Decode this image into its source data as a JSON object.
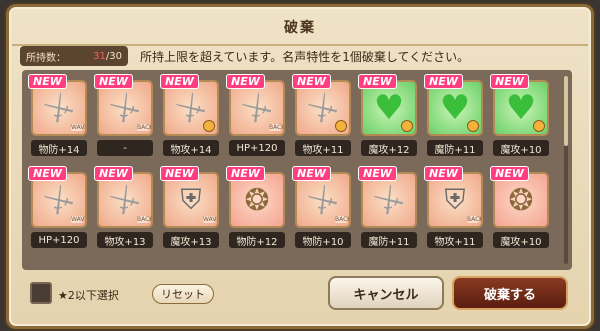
{
  "header": {
    "title": "破棄"
  },
  "inventory": {
    "label": "所持数：",
    "current": "31",
    "max": "/30"
  },
  "instruction": "所持上限を超えています。名声特性を1個破棄してください。",
  "items": [
    {
      "badge": "NEW",
      "icon": "sword-icon",
      "type": "sword",
      "bg": "peach",
      "tag": "WAVE",
      "stat": "物防+14"
    },
    {
      "badge": "NEW",
      "icon": "sword-icon",
      "type": "sword",
      "bg": "peach",
      "tag": "BACK",
      "stat": "-"
    },
    {
      "badge": "NEW",
      "icon": "sword-icon",
      "type": "sword",
      "bg": "peach",
      "tag": "orb",
      "stat": "物攻+14"
    },
    {
      "badge": "NEW",
      "icon": "sword-icon",
      "type": "sword",
      "bg": "peach",
      "tag": "BACK",
      "stat": "HP+120"
    },
    {
      "badge": "NEW",
      "icon": "sword-icon",
      "type": "sword",
      "bg": "peach",
      "tag": "orb",
      "stat": "物攻+11"
    },
    {
      "badge": "NEW",
      "icon": "heart-icon",
      "type": "heart",
      "bg": "green",
      "tag": "orb",
      "stat": "魔攻+12"
    },
    {
      "badge": "NEW",
      "icon": "heart-icon",
      "type": "heart",
      "bg": "green",
      "tag": "orb",
      "stat": "魔防+11"
    },
    {
      "badge": "NEW",
      "icon": "heart-icon",
      "type": "heart",
      "bg": "green",
      "tag": "orb",
      "stat": "魔攻+10"
    },
    {
      "badge": "NEW",
      "icon": "sword-icon",
      "type": "sword",
      "bg": "peach",
      "tag": "WAVE",
      "stat": "HP+120"
    },
    {
      "badge": "NEW",
      "icon": "sword-icon",
      "type": "sword",
      "bg": "peach",
      "tag": "BACK",
      "stat": "物攻+13"
    },
    {
      "badge": "NEW",
      "icon": "shield-icon",
      "type": "shield",
      "bg": "peach",
      "tag": "WAVE",
      "stat": "魔攻+13"
    },
    {
      "badge": "NEW",
      "icon": "ring-icon",
      "type": "ring",
      "bg": "pink",
      "tag": "",
      "stat": "物防+12"
    },
    {
      "badge": "NEW",
      "icon": "sword-icon",
      "type": "sword",
      "bg": "peach",
      "tag": "BACK",
      "stat": "物防+10"
    },
    {
      "badge": "NEW",
      "icon": "sword-icon",
      "type": "sword",
      "bg": "peach",
      "tag": "",
      "stat": "魔防+11"
    },
    {
      "badge": "NEW",
      "icon": "shield-icon",
      "type": "shield",
      "bg": "peach",
      "tag": "BACK",
      "stat": "物攻+11"
    },
    {
      "badge": "NEW",
      "icon": "ring-icon",
      "type": "ring",
      "bg": "pink",
      "tag": "",
      "stat": "魔攻+10"
    }
  ],
  "footer": {
    "filter_label": "★2以下選択",
    "reset_label": "リセット",
    "cancel_label": "キャンセル",
    "discard_label": "破棄する"
  }
}
